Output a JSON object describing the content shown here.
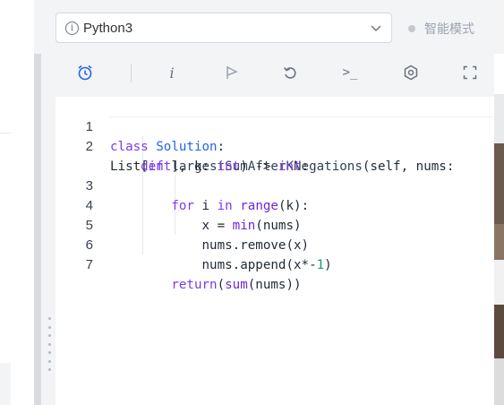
{
  "language_select": {
    "value": "Python3",
    "info_icon": "i"
  },
  "smart_mode": {
    "label": "智能模式"
  },
  "toolbar": {
    "info_label": "i",
    "terminal_label": ">_"
  },
  "editor": {
    "line_numbers": [
      "1",
      "2",
      "3",
      "4",
      "5",
      "6",
      "7"
    ],
    "lines": [
      "class Solution:",
      "    def largestSumAfterKNegations(self, nums:",
      "List[int], k: int) -> int:",
      "        for i in range(k):",
      "            x = min(nums)",
      "            nums.remove(x)",
      "            nums.append(x*-1)",
      "        return(sum(nums))"
    ]
  },
  "colors": {
    "keyword": "#7c3aed",
    "identifier": "#2563eb",
    "number": "#0e9f6e",
    "toolbar_active": "#2563eb",
    "toolbar_icon": "#6b7280"
  }
}
